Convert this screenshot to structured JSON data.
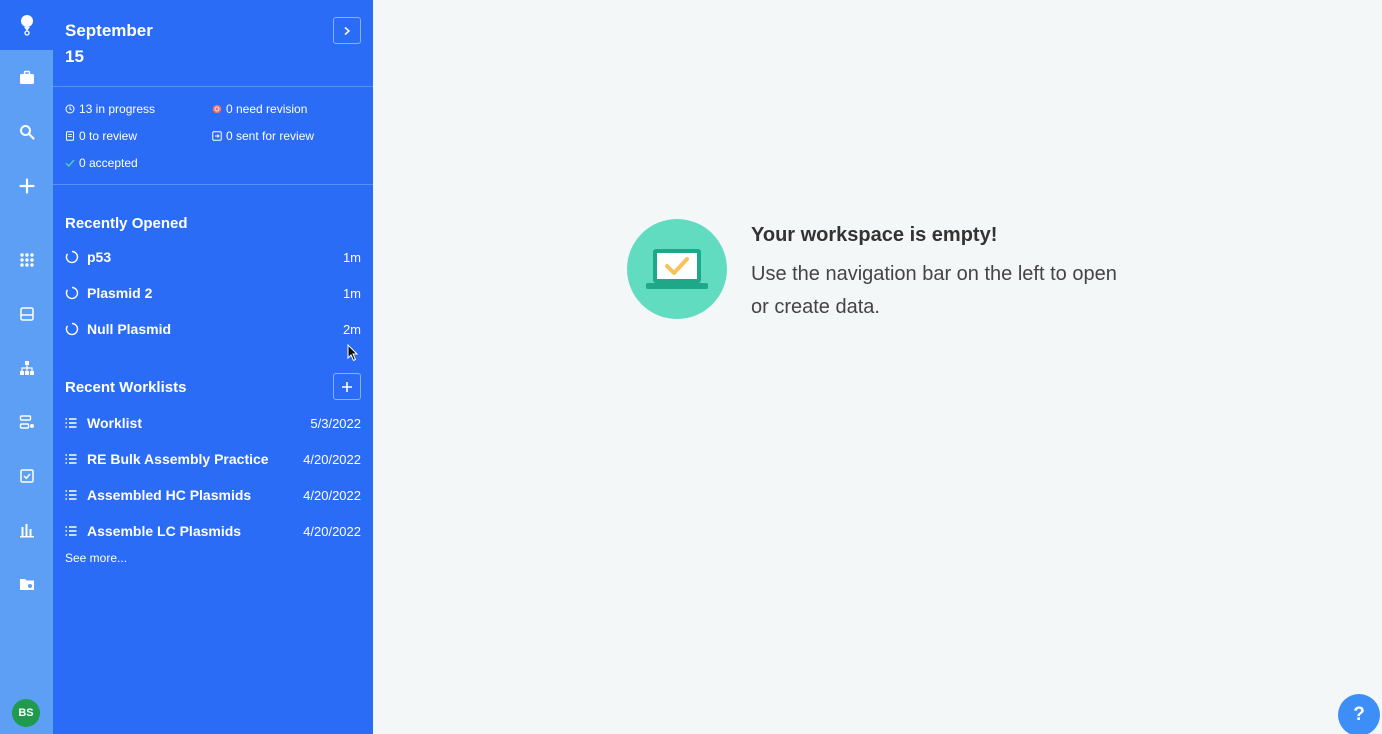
{
  "rail": {
    "icons": [
      "logo-icon",
      "briefcase-icon",
      "search-icon",
      "plus-icon",
      "grid-icon",
      "inbox-icon",
      "hierarchy-icon",
      "workflow-icon",
      "checklist-icon",
      "bar-chart-icon",
      "folder-settings-icon"
    ],
    "avatar": "BS"
  },
  "header": {
    "month": "September",
    "day": "15"
  },
  "stats": {
    "in_progress": "13 in progress",
    "need_revision": "0 need revision",
    "to_review": "0 to review",
    "sent_for_review": "0 sent for review",
    "accepted": "0 accepted"
  },
  "recently_opened": {
    "title": "Recently Opened",
    "items": [
      {
        "name": "p53",
        "time": "1m"
      },
      {
        "name": "Plasmid 2",
        "time": "1m"
      },
      {
        "name": "Null Plasmid",
        "time": "2m"
      }
    ]
  },
  "recent_worklists": {
    "title": "Recent Worklists",
    "items": [
      {
        "name": "Worklist",
        "date": "5/3/2022"
      },
      {
        "name": "RE Bulk Assembly Practice",
        "date": "4/20/2022"
      },
      {
        "name": "Assembled HC Plasmids",
        "date": "4/20/2022"
      },
      {
        "name": "Assemble LC Plasmids",
        "date": "4/20/2022"
      }
    ],
    "see_more": "See more..."
  },
  "empty_state": {
    "title": "Your workspace is empty!",
    "subtitle": "Use the navigation bar on the left to open or create data."
  },
  "help_label": "?",
  "colors": {
    "panel": "#2a6cf6",
    "rail": "#5c9ff5",
    "illus": "#62dcc0",
    "check": "#f5c35a"
  }
}
